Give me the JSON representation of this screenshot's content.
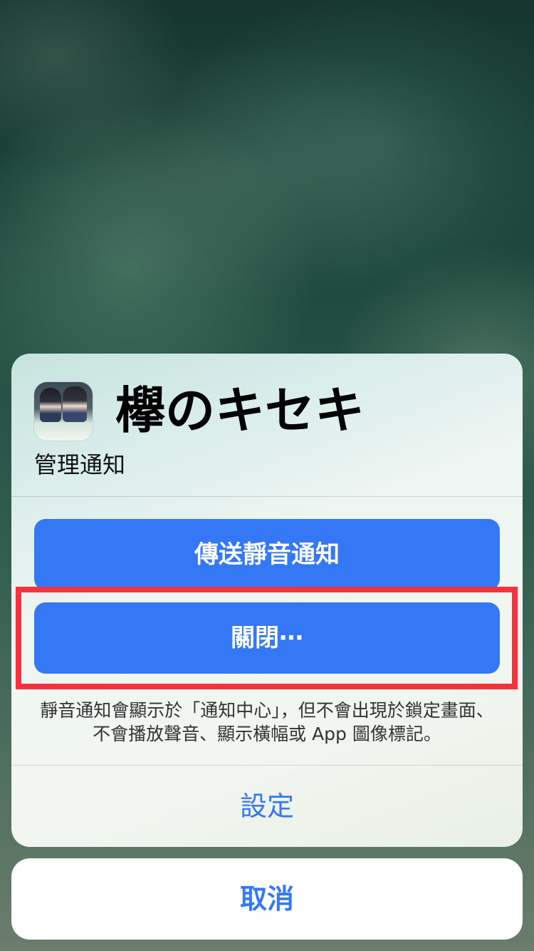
{
  "app": {
    "name": "欅のキセキ",
    "icon": "app-icon-keyaki",
    "icon_logo_text": "欅のキセキ"
  },
  "sheet": {
    "subtitle": "管理通知",
    "buttons": {
      "deliver_quietly": "傳送靜音通知",
      "turn_off": "關閉⋯"
    },
    "footnote": "靜音通知會顯示於「通知中心」，但不會出現於鎖定畫面、不會播放聲音、顯示橫幅或 App 圖像標記。",
    "settings_label": "設定"
  },
  "cancel_label": "取消",
  "colors": {
    "accent": "#3478f6",
    "highlight_border": "#f5333f"
  }
}
